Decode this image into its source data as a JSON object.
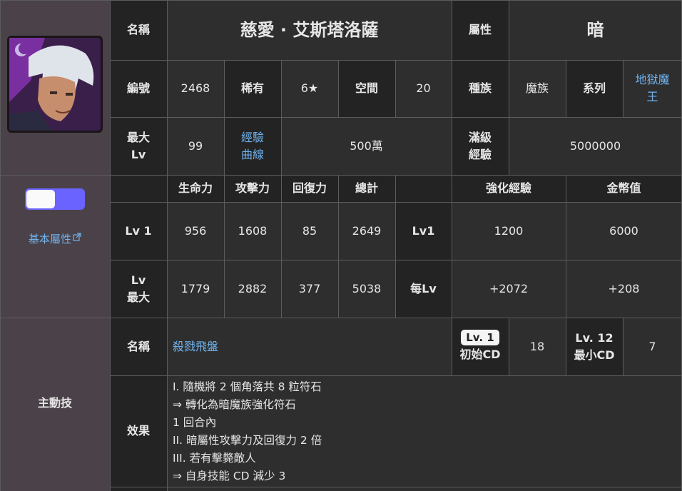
{
  "card": {
    "name_label": "名稱",
    "name": "慈愛 · 艾斯塔洛薩",
    "attr_label": "屬性",
    "attr_value": "暗",
    "id_label": "編號",
    "id_value": "2468",
    "rarity_label": "稀有",
    "rarity_value": "6★",
    "space_label": "空間",
    "space_value": "20",
    "race_label": "種族",
    "race_value": "魔族",
    "series_label": "系列",
    "series_value_1": "地獄魔",
    "series_value_2": "王",
    "maxlv_label_1": "最大",
    "maxlv_label_2": "Lv",
    "maxlv_value": "99",
    "exp_curve_1": "經驗",
    "exp_curve_2": "曲線",
    "exp_curve_value": "500萬",
    "fullexp_label_1": "滿級",
    "fullexp_label_2": "經驗",
    "fullexp_value": "5000000"
  },
  "stats": {
    "toggle_label": "基本屬性",
    "headers": {
      "hp": "生命力",
      "atk": "攻擊力",
      "rec": "回復力",
      "total": "總計",
      "exp": "強化經驗",
      "coin": "金幣值"
    },
    "lv1": {
      "label": "Lv 1",
      "hp": "956",
      "atk": "1608",
      "rec": "85",
      "total": "2649",
      "tag": "Lv1",
      "exp": "1200",
      "coin": "6000"
    },
    "lvmax": {
      "label_1": "Lv",
      "label_2": "最大",
      "hp": "1779",
      "atk": "2882",
      "rec": "377",
      "total": "5038",
      "tag": "每Lv",
      "exp": "+2072",
      "coin": "+208"
    }
  },
  "skill": {
    "section_label": "主動技",
    "name_label": "名稱",
    "name": "殺戮飛盤",
    "init_badge": "Lv. 1",
    "init_label": "初始CD",
    "init_value": "18",
    "min_badge": "Lv. 12",
    "min_label": "最小CD",
    "min_value": "7",
    "effect_label": "效果",
    "effect_lines": [
      "I. 隨機將 2 個角落共 8 粒符石",
      "⇒ 轉化為暗魔族強化符石",
      "1 回合內",
      "II. 暗屬性攻擊力及回復力 2 倍",
      "III. 若有擊斃敵人",
      "⇒ 自身技能 CD 減少 3"
    ]
  }
}
